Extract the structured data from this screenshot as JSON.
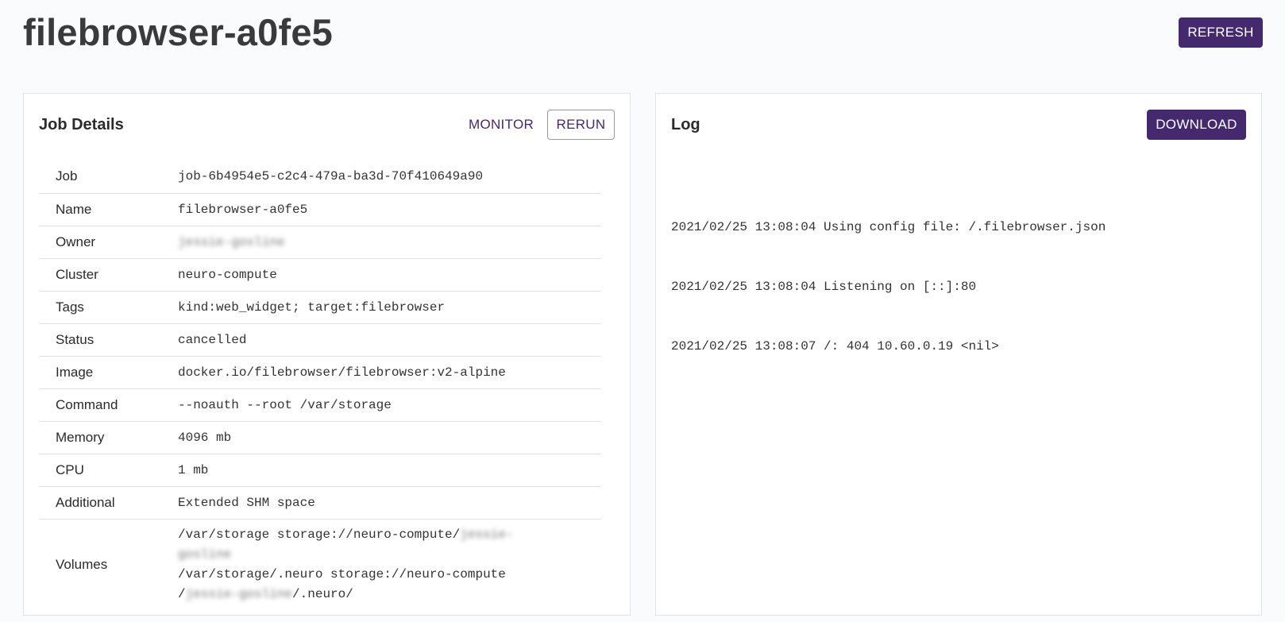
{
  "header": {
    "title": "filebrowser-a0fe5",
    "refresh_label": "REFRESH"
  },
  "job_details": {
    "heading": "Job Details",
    "monitor_label": "MONITOR",
    "rerun_label": "RERUN",
    "rows": [
      {
        "key": "Job",
        "value": "job-6b4954e5-c2c4-479a-ba3d-70f410649a90"
      },
      {
        "key": "Name",
        "value": "filebrowser-a0fe5"
      },
      {
        "key": "Owner",
        "value": "jessie-gosline"
      },
      {
        "key": "Cluster",
        "value": "neuro-compute"
      },
      {
        "key": "Tags",
        "value": "kind:web_widget; target:filebrowser"
      },
      {
        "key": "Status",
        "value": "cancelled"
      },
      {
        "key": "Image",
        "value": "docker.io/filebrowser/filebrowser:v2-alpine"
      },
      {
        "key": "Command",
        "value": "--noauth --root /var/storage"
      },
      {
        "key": "Memory",
        "value": "4096 mb"
      },
      {
        "key": "CPU",
        "value": "1 mb"
      },
      {
        "key": "Additional",
        "value": "Extended SHM space"
      }
    ],
    "volumes": {
      "key": "Volumes",
      "line1_prefix": "/var/storage  storage://neuro-compute/",
      "line1_blur": "jessie-",
      "line2_blur": "gosline",
      "line3": "/var/storage/.neuro  storage://neuro-compute",
      "line4_prefix": "/",
      "line4_blur": "jessie-gosline",
      "line4_suffix": "/.neuro/"
    }
  },
  "log": {
    "heading": "Log",
    "download_label": "DOWNLOAD",
    "lines": [
      "2021/02/25 13:08:04 Using config file: /.filebrowser.json",
      "2021/02/25 13:08:04 Listening on [::]:80",
      "2021/02/25 13:08:07 /: 404 10.60.0.19 <nil>"
    ]
  },
  "icons": {
    "scroll_up": "chevron-up-icon",
    "scroll_down": "chevron-down-icon"
  }
}
